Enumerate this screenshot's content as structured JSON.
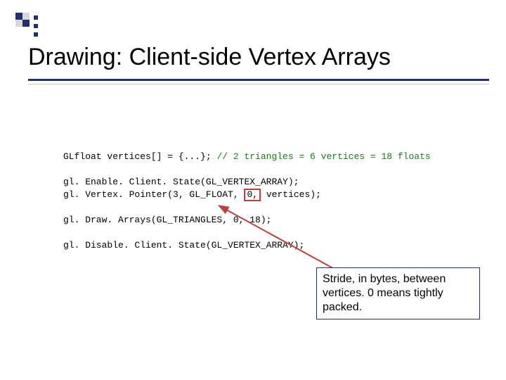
{
  "title": "Drawing:  Client-side Vertex Arrays",
  "code": {
    "l1a": "GLfloat vertices[] = {...}; ",
    "l1b": "// 2 triangles = 6 vertices = 18 floats",
    "l2": "gl. Enable. Client. State(GL_VERTEX_ARRAY);",
    "l3a": "gl. Vertex. Pointer(3, GL_FLOAT, ",
    "l3b": "0,",
    "l3c": " vertices);",
    "l4": "gl. Draw. Arrays(GL_TRIANGLES, 0, 18);",
    "l5": "gl. Disable. Client. State(GL_VERTEX_ARRAY);"
  },
  "callout": "Stride, in bytes, between vertices.  0 means tightly packed."
}
